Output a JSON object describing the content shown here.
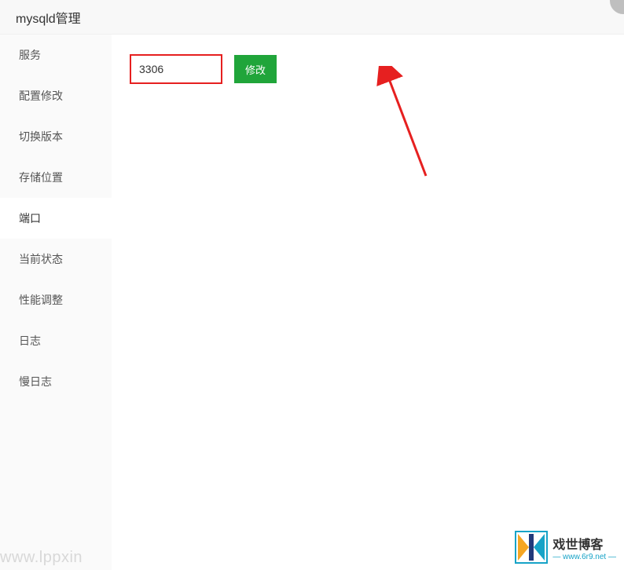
{
  "header": {
    "title": "mysqld管理"
  },
  "sidebar": {
    "items": [
      {
        "label": "服务",
        "id": "service"
      },
      {
        "label": "配置修改",
        "id": "config"
      },
      {
        "label": "切换版本",
        "id": "version"
      },
      {
        "label": "存储位置",
        "id": "storage"
      },
      {
        "label": "端口",
        "id": "port"
      },
      {
        "label": "当前状态",
        "id": "status"
      },
      {
        "label": "性能调整",
        "id": "performance"
      },
      {
        "label": "日志",
        "id": "log"
      },
      {
        "label": "慢日志",
        "id": "slowlog"
      }
    ],
    "activeIndex": 4
  },
  "form": {
    "port_value": "3306",
    "submit_label": "修改"
  },
  "watermark": {
    "left_text": "www.lppxin",
    "logo_title": "戏世博客",
    "logo_sub": "— www.6r9.net —"
  }
}
